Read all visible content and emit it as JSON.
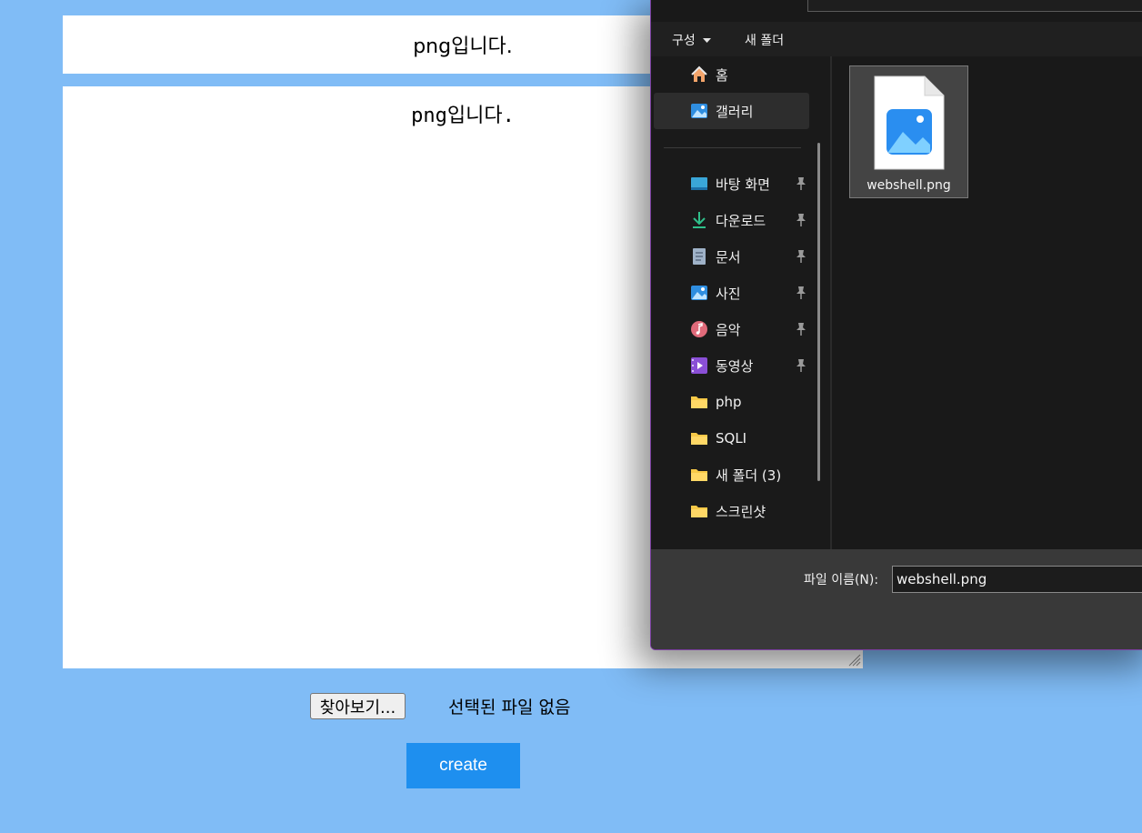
{
  "form": {
    "title_value": "png입니다.",
    "content_value": "png입니다.",
    "browse_label": "찾아보기...",
    "no_file_text": "선택된 파일 없음",
    "create_label": "create"
  },
  "dialog": {
    "toolbar": {
      "organize_label": "구성",
      "new_folder_label": "새 폴더"
    },
    "nav": {
      "home": "홈",
      "gallery": "갤러리",
      "desktop": "바탕 화면",
      "downloads": "다운로드",
      "documents": "문서",
      "pictures": "사진",
      "music": "음악",
      "videos": "동영상",
      "folder_php": "php",
      "folder_sqli": "SQLI",
      "folder_new3": "새 폴더 (3)",
      "folder_screenshots": "스크린샷"
    },
    "files": [
      {
        "name": "webshell.png"
      }
    ],
    "filename_label": "파일 이름(N):",
    "filename_value": "webshell.png"
  },
  "colors": {
    "page_bg": "#80bcf6",
    "create_button": "#1e8fef",
    "dialog_bg": "#191919",
    "dialog_border": "#7b3fa0"
  }
}
